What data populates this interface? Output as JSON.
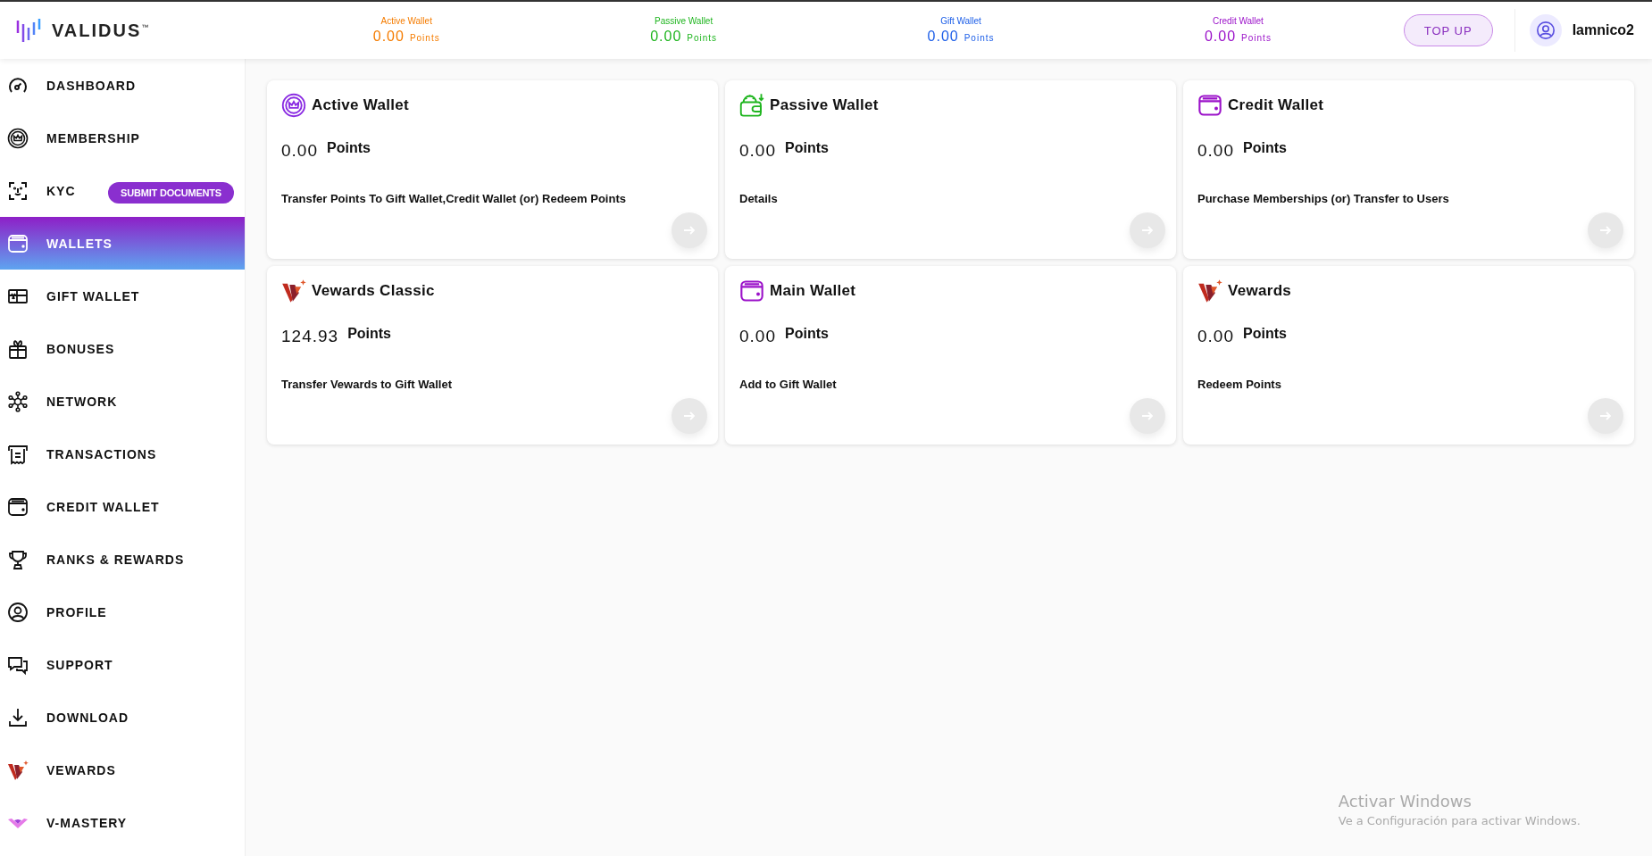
{
  "header": {
    "logo": "VALIDUS",
    "logo_mark": "™",
    "wallets": [
      {
        "label": "Active Wallet",
        "amount": "0.00",
        "unit": "Points",
        "color": "#f57c00"
      },
      {
        "label": "Passive Wallet",
        "amount": "0.00",
        "unit": "Points",
        "color": "#1fb51f"
      },
      {
        "label": "Gift Wallet",
        "amount": "0.00",
        "unit": "Points",
        "color": "#1c5ee8"
      },
      {
        "label": "Credit Wallet",
        "amount": "0.00",
        "unit": "Points",
        "color": "#9b12c9"
      }
    ],
    "top_up": "TOP UP",
    "username": "Iamnico2"
  },
  "sidebar": {
    "items": [
      {
        "label": "DASHBOARD",
        "selected": false
      },
      {
        "label": "MEMBERSHIP",
        "selected": false
      },
      {
        "label": "KYC",
        "selected": false,
        "badge": "SUBMIT DOCUMENTS"
      },
      {
        "label": "WALLETS",
        "selected": true
      },
      {
        "label": "GIFT WALLET",
        "selected": false
      },
      {
        "label": "BONUSES",
        "selected": false
      },
      {
        "label": "NETWORK",
        "selected": false
      },
      {
        "label": "TRANSACTIONS",
        "selected": false
      },
      {
        "label": "CREDIT WALLET",
        "selected": false
      },
      {
        "label": "RANKS & REWARDS",
        "selected": false
      },
      {
        "label": "PROFILE",
        "selected": false
      },
      {
        "label": "SUPPORT",
        "selected": false
      },
      {
        "label": "DOWNLOAD",
        "selected": false
      },
      {
        "label": "VEWARDS",
        "selected": false
      },
      {
        "label": "V-MASTERY",
        "selected": false
      }
    ]
  },
  "cards": [
    {
      "title": "Active Wallet",
      "amount": "0.00",
      "unit": "Points",
      "description": "Transfer Points To Gift Wallet,Credit Wallet (or) Redeem Points"
    },
    {
      "title": "Passive Wallet",
      "amount": "0.00",
      "unit": "Points",
      "description": "Details"
    },
    {
      "title": "Credit Wallet",
      "amount": "0.00",
      "unit": "Points",
      "description": "Purchase Memberships (or) Transfer to Users"
    },
    {
      "title": "Vewards Classic",
      "amount": "124.93",
      "unit": "Points",
      "description": "Transfer Vewards to Gift Wallet"
    },
    {
      "title": "Main Wallet",
      "amount": "0.00",
      "unit": "Points",
      "description": "Add to Gift Wallet"
    },
    {
      "title": "Vewards",
      "amount": "0.00",
      "unit": "Points",
      "description": "Redeem Points"
    }
  ],
  "os_notice": {
    "title": "Activar Windows",
    "text": "Ve a Configuración para activar Windows."
  }
}
